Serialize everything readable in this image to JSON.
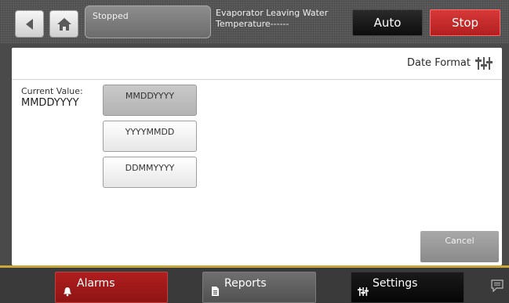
{
  "header": {
    "back_icon": "left-arrow-icon",
    "home_icon": "home-icon",
    "status": "Stopped",
    "evaporator_label_line1": "Evaporator Leaving Water",
    "evaporator_label_line2": "Temperature------",
    "auto_label": "Auto",
    "stop_label": "Stop",
    "colors": {
      "stop": "#c62828",
      "auto": "#141414"
    }
  },
  "panel": {
    "title": "Date Format",
    "title_icon": "settings-sliders-icon",
    "current_value_label": "Current Value:",
    "current_value": "MMDDYYYY",
    "options": [
      {
        "label": "MMDDYYYY",
        "selected": true
      },
      {
        "label": "YYYYMMDD",
        "selected": false
      },
      {
        "label": "DDMMYYYY",
        "selected": false
      }
    ],
    "cancel_label": "Cancel"
  },
  "footer": {
    "tabs": [
      {
        "label": "Alarms",
        "icon": "bell-icon",
        "color": "#a51a1a"
      },
      {
        "label": "Reports",
        "icon": "document-icon"
      },
      {
        "label": "Settings",
        "icon": "settings-sliders-icon"
      }
    ],
    "chat_icon": "chat-bubble-icon"
  }
}
